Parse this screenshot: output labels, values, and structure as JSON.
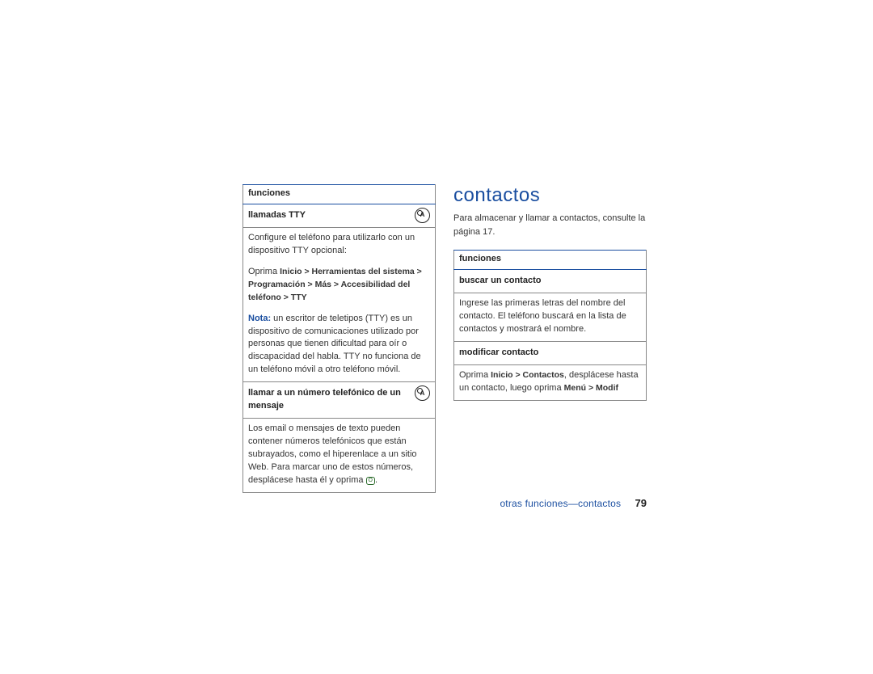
{
  "left": {
    "header": "funciones",
    "row1_title": "llamadas TTY",
    "row1_p1": "Configure el teléfono para utilizarlo con un dispositivo TTY opcional:",
    "row1_p2_prefix": "Oprima ",
    "row1_path": "Inicio > Herramientas del sistema > Programación > Más > Accesibilidad del teléfono > TTY",
    "row1_nota_label": "Nota:",
    "row1_nota_text": " un escritor de teletipos (TTY) es un dispositivo de comunicaciones utilizado por personas que tienen dificultad para oír o discapacidad del habla. TTY no funciona de un teléfono móvil a otro teléfono móvil.",
    "row2_title": "llamar a un número telefónico de un mensaje",
    "row2_body_prefix": "Los email o mensajes de texto pueden contener números telefónicos que están subrayados, como el hiperenlace a un sitio Web. Para marcar uno de estos números, desplácese hasta él y oprima ",
    "row2_btn": "O",
    "row2_body_suffix": "."
  },
  "right": {
    "heading": "contactos",
    "intro": "Para almacenar y llamar a contactos, consulte la página 17.",
    "header": "funciones",
    "r1_title": "buscar un contacto",
    "r1_body": "Ingrese las primeras letras del nombre del contacto. El teléfono buscará en la lista de contactos y mostrará el nombre.",
    "r2_title": "modificar contacto",
    "r2_prefix": "Oprima ",
    "r2_path1": "Inicio > Contactos",
    "r2_mid": ", desplácese hasta un contacto, luego oprima ",
    "r2_path2": "Menú > Modif"
  },
  "footer": {
    "crumb": "otras funciones—contactos",
    "page": "79"
  }
}
